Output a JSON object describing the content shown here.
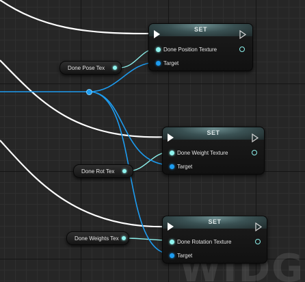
{
  "graph": {
    "watermark": "WIDGET",
    "set_nodes": [
      {
        "title": "SET",
        "input_label": "Done Position Texture",
        "target_label": "Target"
      },
      {
        "title": "SET",
        "input_label": "Done Weight Texture",
        "target_label": "Target"
      },
      {
        "title": "SET",
        "input_label": "Done Rotation Texture",
        "target_label": "Target"
      }
    ],
    "variable_nodes": [
      {
        "label": "Done Pose Tex"
      },
      {
        "label": "Done Rot Tex"
      },
      {
        "label": "Done Weights Tex"
      }
    ],
    "colors": {
      "exec_wire": "#ffffff",
      "object_wire": "#1d9cf0",
      "texture_wire": "#8ff3ee",
      "node_header": "#4a6466"
    }
  }
}
